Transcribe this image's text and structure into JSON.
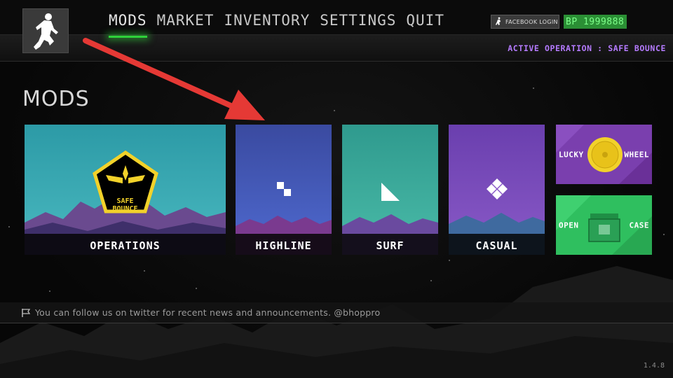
{
  "nav": {
    "items": [
      {
        "label": "MODS",
        "active": true
      },
      {
        "label": "MARKET"
      },
      {
        "label": "INVENTORY"
      },
      {
        "label": "SETTINGS"
      },
      {
        "label": "QUIT"
      }
    ]
  },
  "account": {
    "facebook_label": "FACEBOOK LOGIN",
    "bp_label": "BP 1999888"
  },
  "active_operation": "ACTIVE OPERATION : SAFE BOUNCE",
  "page_title": "MODS",
  "cards": {
    "operations": {
      "label": "OPERATIONS",
      "badge_line1": "SAFE",
      "badge_line2": "BOUNCE"
    },
    "highline": {
      "label": "HIGHLINE"
    },
    "surf": {
      "label": "SURF"
    },
    "casual": {
      "label": "CASUAL"
    }
  },
  "side_cards": {
    "lucky_wheel": {
      "left": "LUCKY",
      "right": "WHEEL"
    },
    "open_case": {
      "left": "OPEN",
      "right": "CASE"
    }
  },
  "news": "You can follow us on twitter for recent news and announcements. @bhoppro",
  "version": "1.4.8",
  "colors": {
    "accent_green": "#2fd23a",
    "operation_purple": "#b57bff",
    "badge_yellow": "#f2d22a",
    "case_green": "#2fbf5f",
    "wheel_purple": "#7a3fae"
  }
}
